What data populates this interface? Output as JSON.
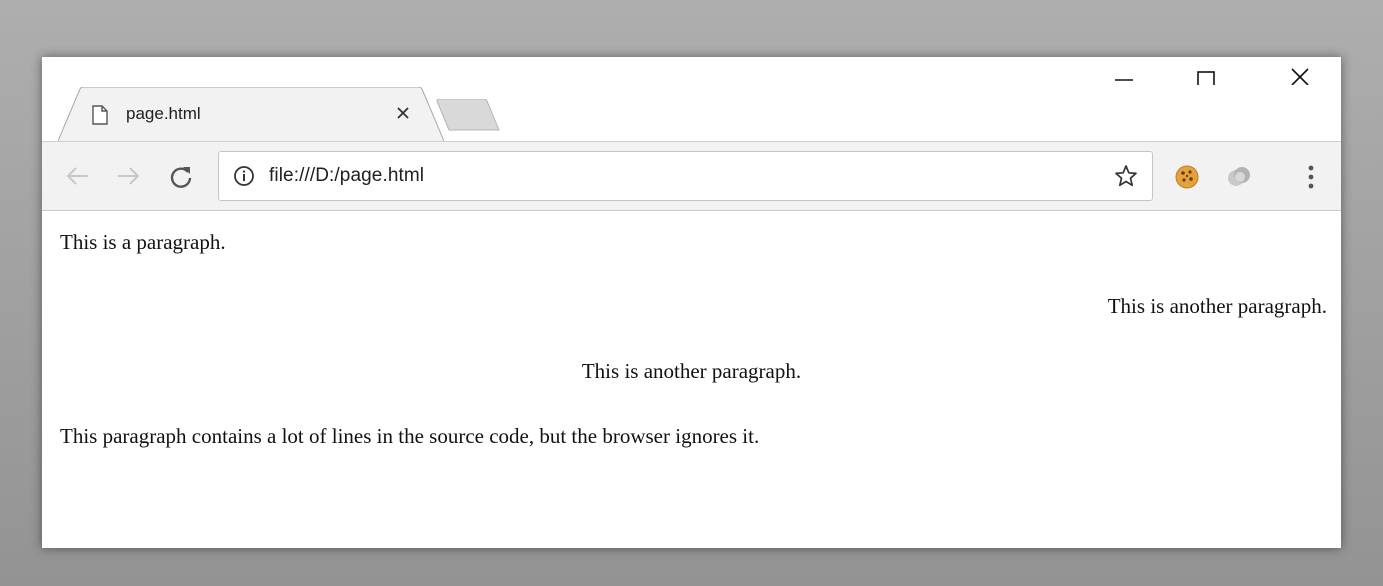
{
  "tab": {
    "title": "page.html",
    "icon": "document-icon"
  },
  "window_controls": {
    "minimize": "minimize-icon",
    "maximize": "maximize-icon",
    "close": "close-icon"
  },
  "toolbar": {
    "back_icon": "back-arrow-icon",
    "forward_icon": "forward-arrow-icon",
    "reload_icon": "reload-icon",
    "url": "file:///D:/page.html",
    "extensions": [
      "cookie-icon",
      "extension-icon"
    ],
    "menu_icon": "more-vert-icon"
  },
  "page": {
    "paragraphs": [
      {
        "text": "This is a paragraph.",
        "align": "left"
      },
      {
        "text": "This is another paragraph.",
        "align": "right"
      },
      {
        "text": "This is another paragraph.",
        "align": "center"
      },
      {
        "text": "This paragraph contains a lot of lines in the source code, but the browser ignores it.",
        "align": "left"
      }
    ]
  },
  "colors": {
    "frame": "#f2f2f2",
    "page_background": "#ffffff",
    "text": "#111111"
  }
}
